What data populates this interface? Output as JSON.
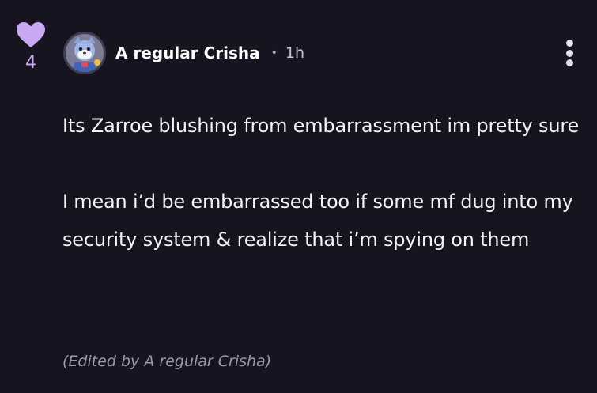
{
  "vote": {
    "count": "4",
    "icon": "heart-icon",
    "color": "#c9a8f4"
  },
  "comment": {
    "author": "A regular Crisha",
    "separator": "•",
    "time": "1h",
    "paragraphs": [
      "Its Zarroe blushing from embarrassment im pretty sure",
      "I mean i’d be embarrassed too if some mf dug into my security system & realize that i’m spying on them"
    ],
    "edited_note": "(Edited by A regular Crisha)"
  },
  "menu": {
    "icon": "more-options-icon"
  },
  "theme": {
    "background": "#15141f",
    "text": "#f3f3f6",
    "muted": "#9d9aaa"
  }
}
